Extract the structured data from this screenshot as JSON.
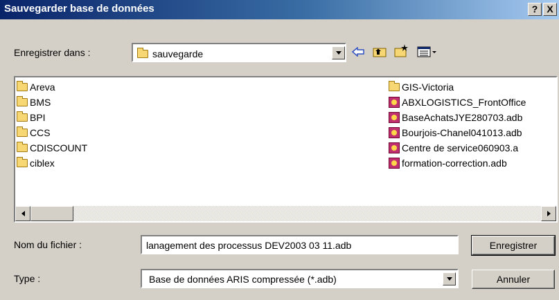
{
  "window": {
    "title": "Sauvegarder base de données",
    "help_label": "?",
    "close_label": "X"
  },
  "save_in": {
    "label": "Enregistrer dans :",
    "value": "sauvegarde"
  },
  "files_left": [
    {
      "name": "Areva",
      "icon": "folder-icon"
    },
    {
      "name": "BMS",
      "icon": "folder-icon"
    },
    {
      "name": "BPI",
      "icon": "folder-icon"
    },
    {
      "name": "CCS",
      "icon": "folder-icon"
    },
    {
      "name": "CDISCOUNT",
      "icon": "folder-icon"
    },
    {
      "name": "ciblex",
      "icon": "folder-icon"
    }
  ],
  "files_right": [
    {
      "name": "GIS-Victoria",
      "icon": "folder-icon"
    },
    {
      "name": "ABXLOGISTICS_FrontOffice",
      "icon": "aris-db-icon"
    },
    {
      "name": "BaseAchatsJYE280703.adb",
      "icon": "aris-db-icon"
    },
    {
      "name": "Bourjois-Chanel041013.adb",
      "icon": "aris-db-icon"
    },
    {
      "name": "Centre de service060903.a",
      "icon": "aris-db-icon"
    },
    {
      "name": "formation-correction.adb",
      "icon": "aris-db-icon"
    }
  ],
  "filename": {
    "label": "Nom du fichier :",
    "value": "lanagement des processus DEV2003 03 11.adb"
  },
  "type": {
    "label": "Type :",
    "value": "Base de données ARIS compressée (*.adb)"
  },
  "buttons": {
    "save": "Enregistrer",
    "cancel": "Annuler"
  }
}
